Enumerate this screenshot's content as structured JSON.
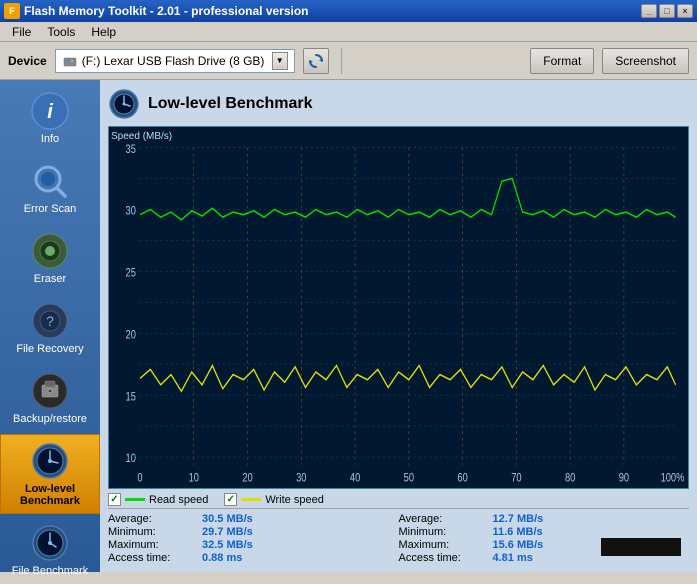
{
  "titleBar": {
    "title": "Flash Memory Toolkit - 2.01 - professional version",
    "controls": [
      "minimize",
      "maximize",
      "close"
    ]
  },
  "menuBar": {
    "items": [
      "File",
      "Tools",
      "Help"
    ]
  },
  "toolbar": {
    "deviceLabel": "Device",
    "deviceText": "(F:) Lexar  USB Flash Drive (8 GB)",
    "dropdownArrow": "▼",
    "refreshIcon": "↻",
    "formatLabel": "Format",
    "screenshotLabel": "Screenshot"
  },
  "sidebar": {
    "items": [
      {
        "id": "info",
        "label": "Info",
        "active": false
      },
      {
        "id": "error-scan",
        "label": "Error Scan",
        "active": false
      },
      {
        "id": "eraser",
        "label": "Eraser",
        "active": false
      },
      {
        "id": "file-recovery",
        "label": "File Recovery",
        "active": false
      },
      {
        "id": "backup-restore",
        "label": "Backup/restore",
        "active": false
      },
      {
        "id": "low-level-benchmark",
        "label": "Low-level Benchmark",
        "active": true
      },
      {
        "id": "file-benchmark",
        "label": "File Benchmark",
        "active": false
      }
    ]
  },
  "content": {
    "title": "Low-level Benchmark",
    "chart": {
      "yAxisLabel": "Speed (MB/s)",
      "yMax": 35,
      "yMin": 0,
      "xLabels": [
        "0",
        "10",
        "20",
        "30",
        "40",
        "50",
        "60",
        "70",
        "80",
        "90",
        "100%"
      ]
    },
    "legend": {
      "readLabel": "Read speed",
      "writeLabel": "Write speed"
    },
    "statsLeft": {
      "averageLabel": "Average:",
      "averageValue": "30.5 MB/s",
      "minimumLabel": "Minimum:",
      "minimumValue": "29.7 MB/s",
      "maximumLabel": "Maximum:",
      "maximumValue": "32.5 MB/s",
      "accessTimeLabel": "Access time:",
      "accessTimeValue": "0.88 ms"
    },
    "statsRight": {
      "averageLabel": "Average:",
      "averageValue": "12.7 MB/s",
      "minimumLabel": "Minimum:",
      "minimumValue": "11.6 MB/s",
      "maximumLabel": "Maximum:",
      "maximumValue": "15.6 MB/s",
      "accessTimeLabel": "Access time:",
      "accessTimeValue": "4.81 ms"
    }
  }
}
